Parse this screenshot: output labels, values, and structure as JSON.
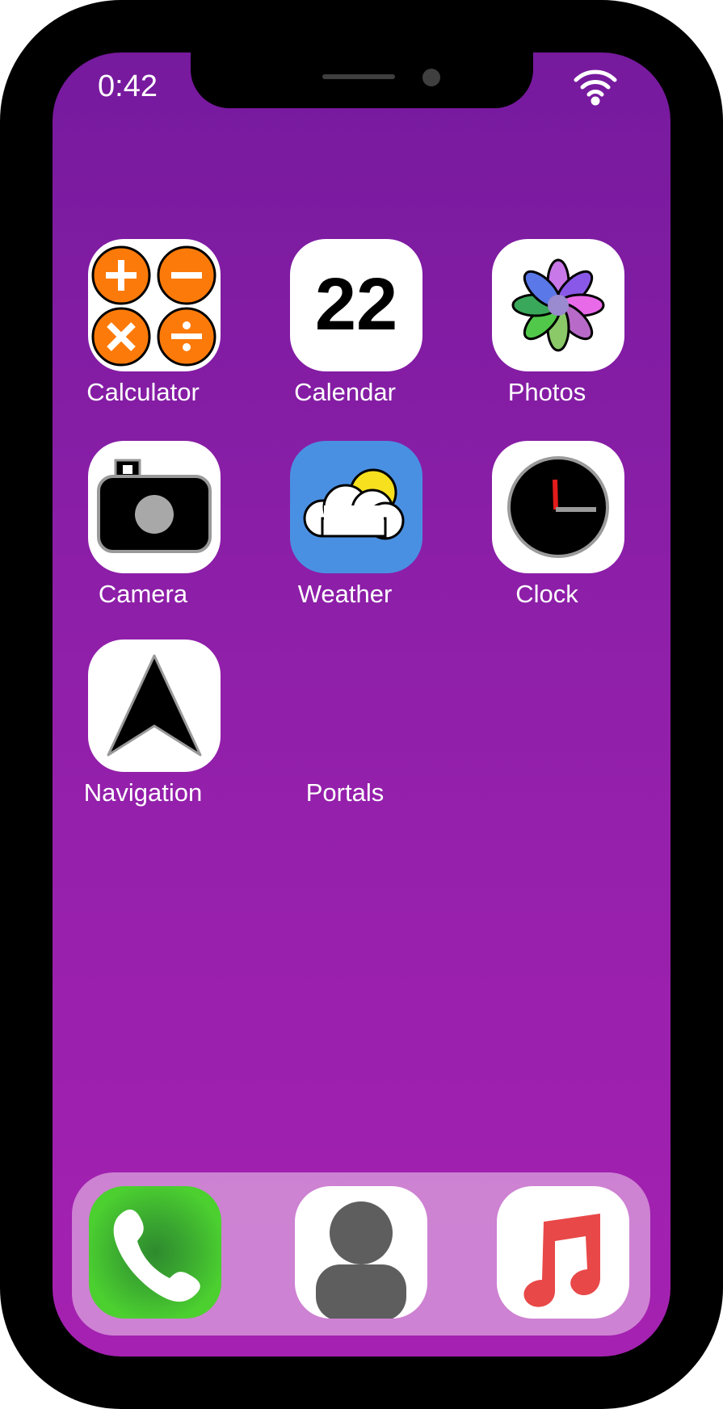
{
  "status_bar": {
    "time": "0:42",
    "wifi_icon": "wifi-icon"
  },
  "apps": [
    {
      "label": "Calculator",
      "icon": "calculator-icon"
    },
    {
      "label": "Calendar",
      "icon": "calendar-icon",
      "date": "22"
    },
    {
      "label": "Photos",
      "icon": "photos-icon"
    },
    {
      "label": "Camera",
      "icon": "camera-icon"
    },
    {
      "label": "Weather",
      "icon": "weather-icon"
    },
    {
      "label": "Clock",
      "icon": "clock-icon"
    },
    {
      "label": "Navigation",
      "icon": "navigation-icon"
    },
    {
      "label": "Portals",
      "icon": ""
    }
  ],
  "dock": [
    {
      "icon": "phone-icon"
    },
    {
      "icon": "contacts-icon"
    },
    {
      "icon": "music-icon"
    }
  ],
  "colors": {
    "wallpaper_top": "#761a9e",
    "wallpaper_bottom": "#a521b1",
    "calculator_orange": "#fb7a0a",
    "weather_blue": "#4a90e2",
    "phone_green": "#3fc22c",
    "music_red": "#e84848"
  }
}
